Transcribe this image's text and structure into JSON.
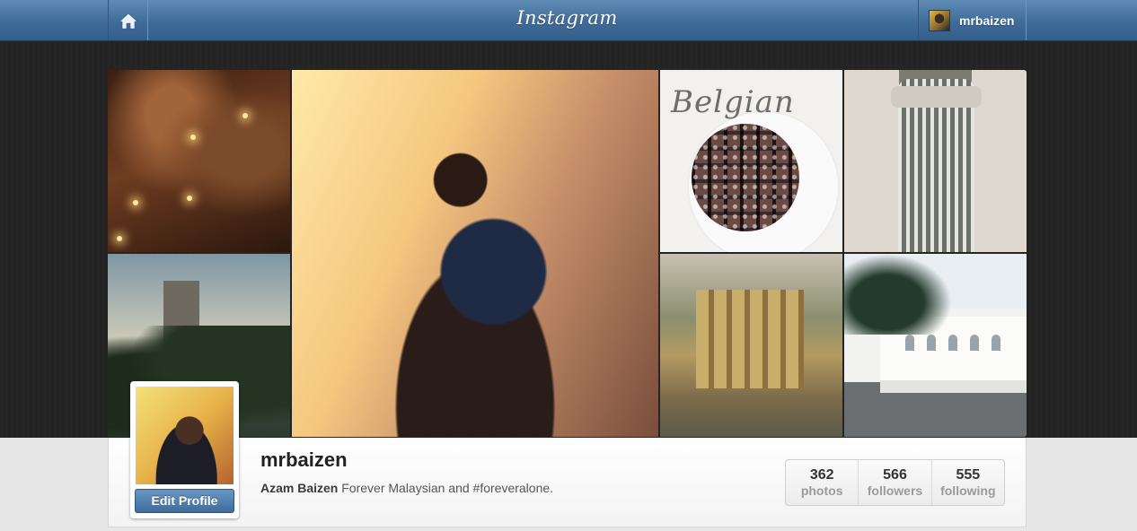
{
  "header": {
    "brand": "Instagram",
    "username": "mrbaizen",
    "home_icon": "home-icon",
    "avatar_icon": "user-avatar"
  },
  "photos": [
    {
      "name": "cave"
    },
    {
      "name": "city-trees"
    },
    {
      "name": "cafe-portrait"
    },
    {
      "name": "waffle",
      "caption": "Belgian"
    },
    {
      "name": "tower"
    },
    {
      "name": "ruins"
    },
    {
      "name": "colonial-building"
    }
  ],
  "profile": {
    "username": "mrbaizen",
    "full_name": "Azam Baizen",
    "bio": "Forever Malaysian and #foreveralone.",
    "edit_label": "Edit Profile"
  },
  "stats": [
    {
      "count": "362",
      "label": "photos"
    },
    {
      "count": "566",
      "label": "followers"
    },
    {
      "count": "555",
      "label": "following"
    }
  ],
  "colors": {
    "topbar": "#3f6b98",
    "button": "#4a78a8",
    "backdrop": "#242424"
  }
}
